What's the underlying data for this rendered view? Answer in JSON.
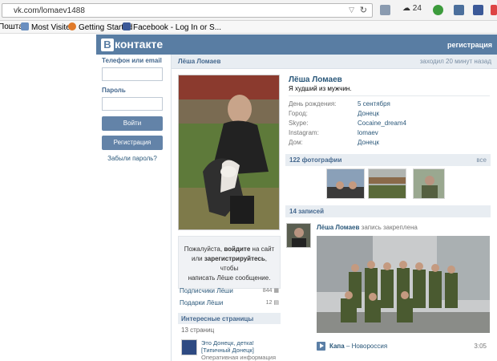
{
  "browser": {
    "url": "vk.com/lomaev1488",
    "weather_temp": "24",
    "bookmarks": [
      "Пошта",
      "Most Visited",
      "Getting Started",
      "Facebook - Log In or S..."
    ]
  },
  "header": {
    "logo_text": "контакте",
    "logo_letter": "В",
    "register": "регистрация"
  },
  "login": {
    "phone_label": "Телефон или email",
    "password_label": "Пароль",
    "login_button": "Войти",
    "register_button": "Регистрация",
    "forgot": "Забыли пароль?"
  },
  "profile": {
    "name_bar": "Лёша Ломаев",
    "last_seen": "заходил 20 минут назад",
    "name": "Лёша Ломаев",
    "status": "Я худший из мужчин.",
    "fields": [
      {
        "key": "День рождения:",
        "value": "5 сентября"
      },
      {
        "key": "Город:",
        "value": "Донецк"
      },
      {
        "key": "Skype:",
        "value": "Cocaine_dream4"
      },
      {
        "key": "Instagram:",
        "value": "lomaev"
      },
      {
        "key": "Дом:",
        "value": "Донецк"
      }
    ],
    "guest_msg_1": "Пожалуйста,",
    "guest_msg_login": "войдите",
    "guest_msg_2": "на сайт или",
    "guest_msg_register": "зарегистрируйтесь",
    "guest_msg_3": ", чтобы",
    "guest_msg_4": "написать Лёше сообщение.",
    "followers_label": "Подписчики Лёши",
    "followers_count": "844",
    "gifts_label": "Подарки Лёши",
    "gifts_count": "12",
    "interesting_title": "Интересные страницы",
    "interesting_count": "13 страниц",
    "group_line1": "Это Донецк, детка!",
    "group_line2": "[Типичный Донецк]",
    "group_line3": "Оперативная информация"
  },
  "photos": {
    "title": "122 фотографии",
    "all": "все"
  },
  "wall": {
    "title": "14 записей",
    "author": "Лёша Ломаев",
    "pinned": "запись закреплена",
    "audio_artist": "Капа",
    "audio_title": "– Новороссия",
    "audio_time": "3:05"
  },
  "colors": {
    "vk_blue": "#597da3",
    "link": "#2b587a",
    "bar_bg": "#e8edf2"
  }
}
